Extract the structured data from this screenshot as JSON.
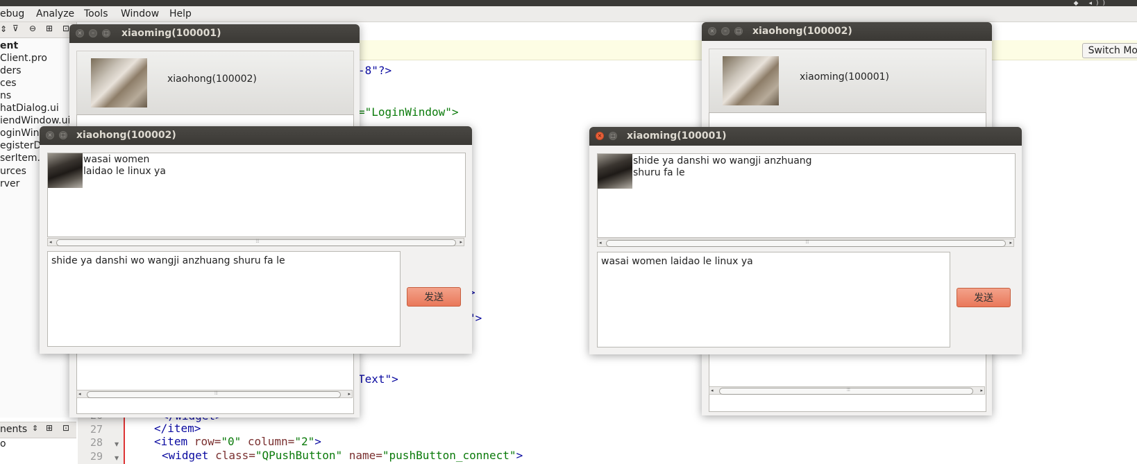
{
  "menubar": {
    "items": [
      {
        "label": "ebug"
      },
      {
        "label": "Analyze"
      },
      {
        "label": "Tools"
      },
      {
        "label": "Window"
      },
      {
        "label": "Help"
      }
    ]
  },
  "sidebar": {
    "items": [
      {
        "label": "ent"
      },
      {
        "label": "Client.pro"
      },
      {
        "label": "ders"
      },
      {
        "label": "ces"
      },
      {
        "label": "ns"
      },
      {
        "label": "hatDialog.ui"
      },
      {
        "label": "iendWindow.ui"
      },
      {
        "label": "oginWindow"
      },
      {
        "label": "egisterDi"
      },
      {
        "label": "serItem.u"
      },
      {
        "label": "urces"
      },
      {
        "label": "rver"
      }
    ],
    "open_documents_label": "nents",
    "open_documents_item": "o"
  },
  "editor": {
    "switch_mode_label": "Switch Mo",
    "line_numbers": [
      "27",
      "28",
      "29"
    ],
    "partial_line_number": "26",
    "code_fragments": {
      "encoding": "-8\"?>",
      "name_attr": "=\"LoginWindow\">",
      "frag1": ">",
      "frag2": "\">",
      "text_attr": "Text\">",
      "line26": "</widget>",
      "line27": "</item>",
      "line28_tag": "<item",
      "line28_row": " row=",
      "line28_rowval": "\"0\"",
      "line28_col": " column=",
      "line28_colval": "\"2\"",
      "line28_end": ">",
      "line29_tag": "<widget",
      "line29_class": " class=",
      "line29_classval": "\"QPushButton\"",
      "line29_name": " name=",
      "line29_nameval": "\"pushButton_connect\"",
      "line29_end": ">"
    }
  },
  "windows": {
    "left_back": {
      "title": "xiaoming(100001)",
      "contact": "xiaohong(100002)"
    },
    "left_front": {
      "title": "xiaohong(100002)",
      "messages": [
        "wasai  women",
        "laidao le  linux ya"
      ],
      "input_text": "shide ya  danshi wo wangji anzhuang shuru fa le",
      "send_label": "发送"
    },
    "right_back": {
      "title": "xiaohong(100002)",
      "contact": "xiaoming(100001)"
    },
    "right_front": {
      "title": "xiaoming(100001)",
      "messages": [
        "shide ya  danshi wo wangji anzhuang",
        "shuru fa le"
      ],
      "input_text": "wasai  women laidao le  linux ya",
      "send_label": "发送"
    }
  },
  "colors": {
    "titlebar": "#3b3935",
    "send_button": "#e9785a",
    "close_active": "#e9603a"
  }
}
